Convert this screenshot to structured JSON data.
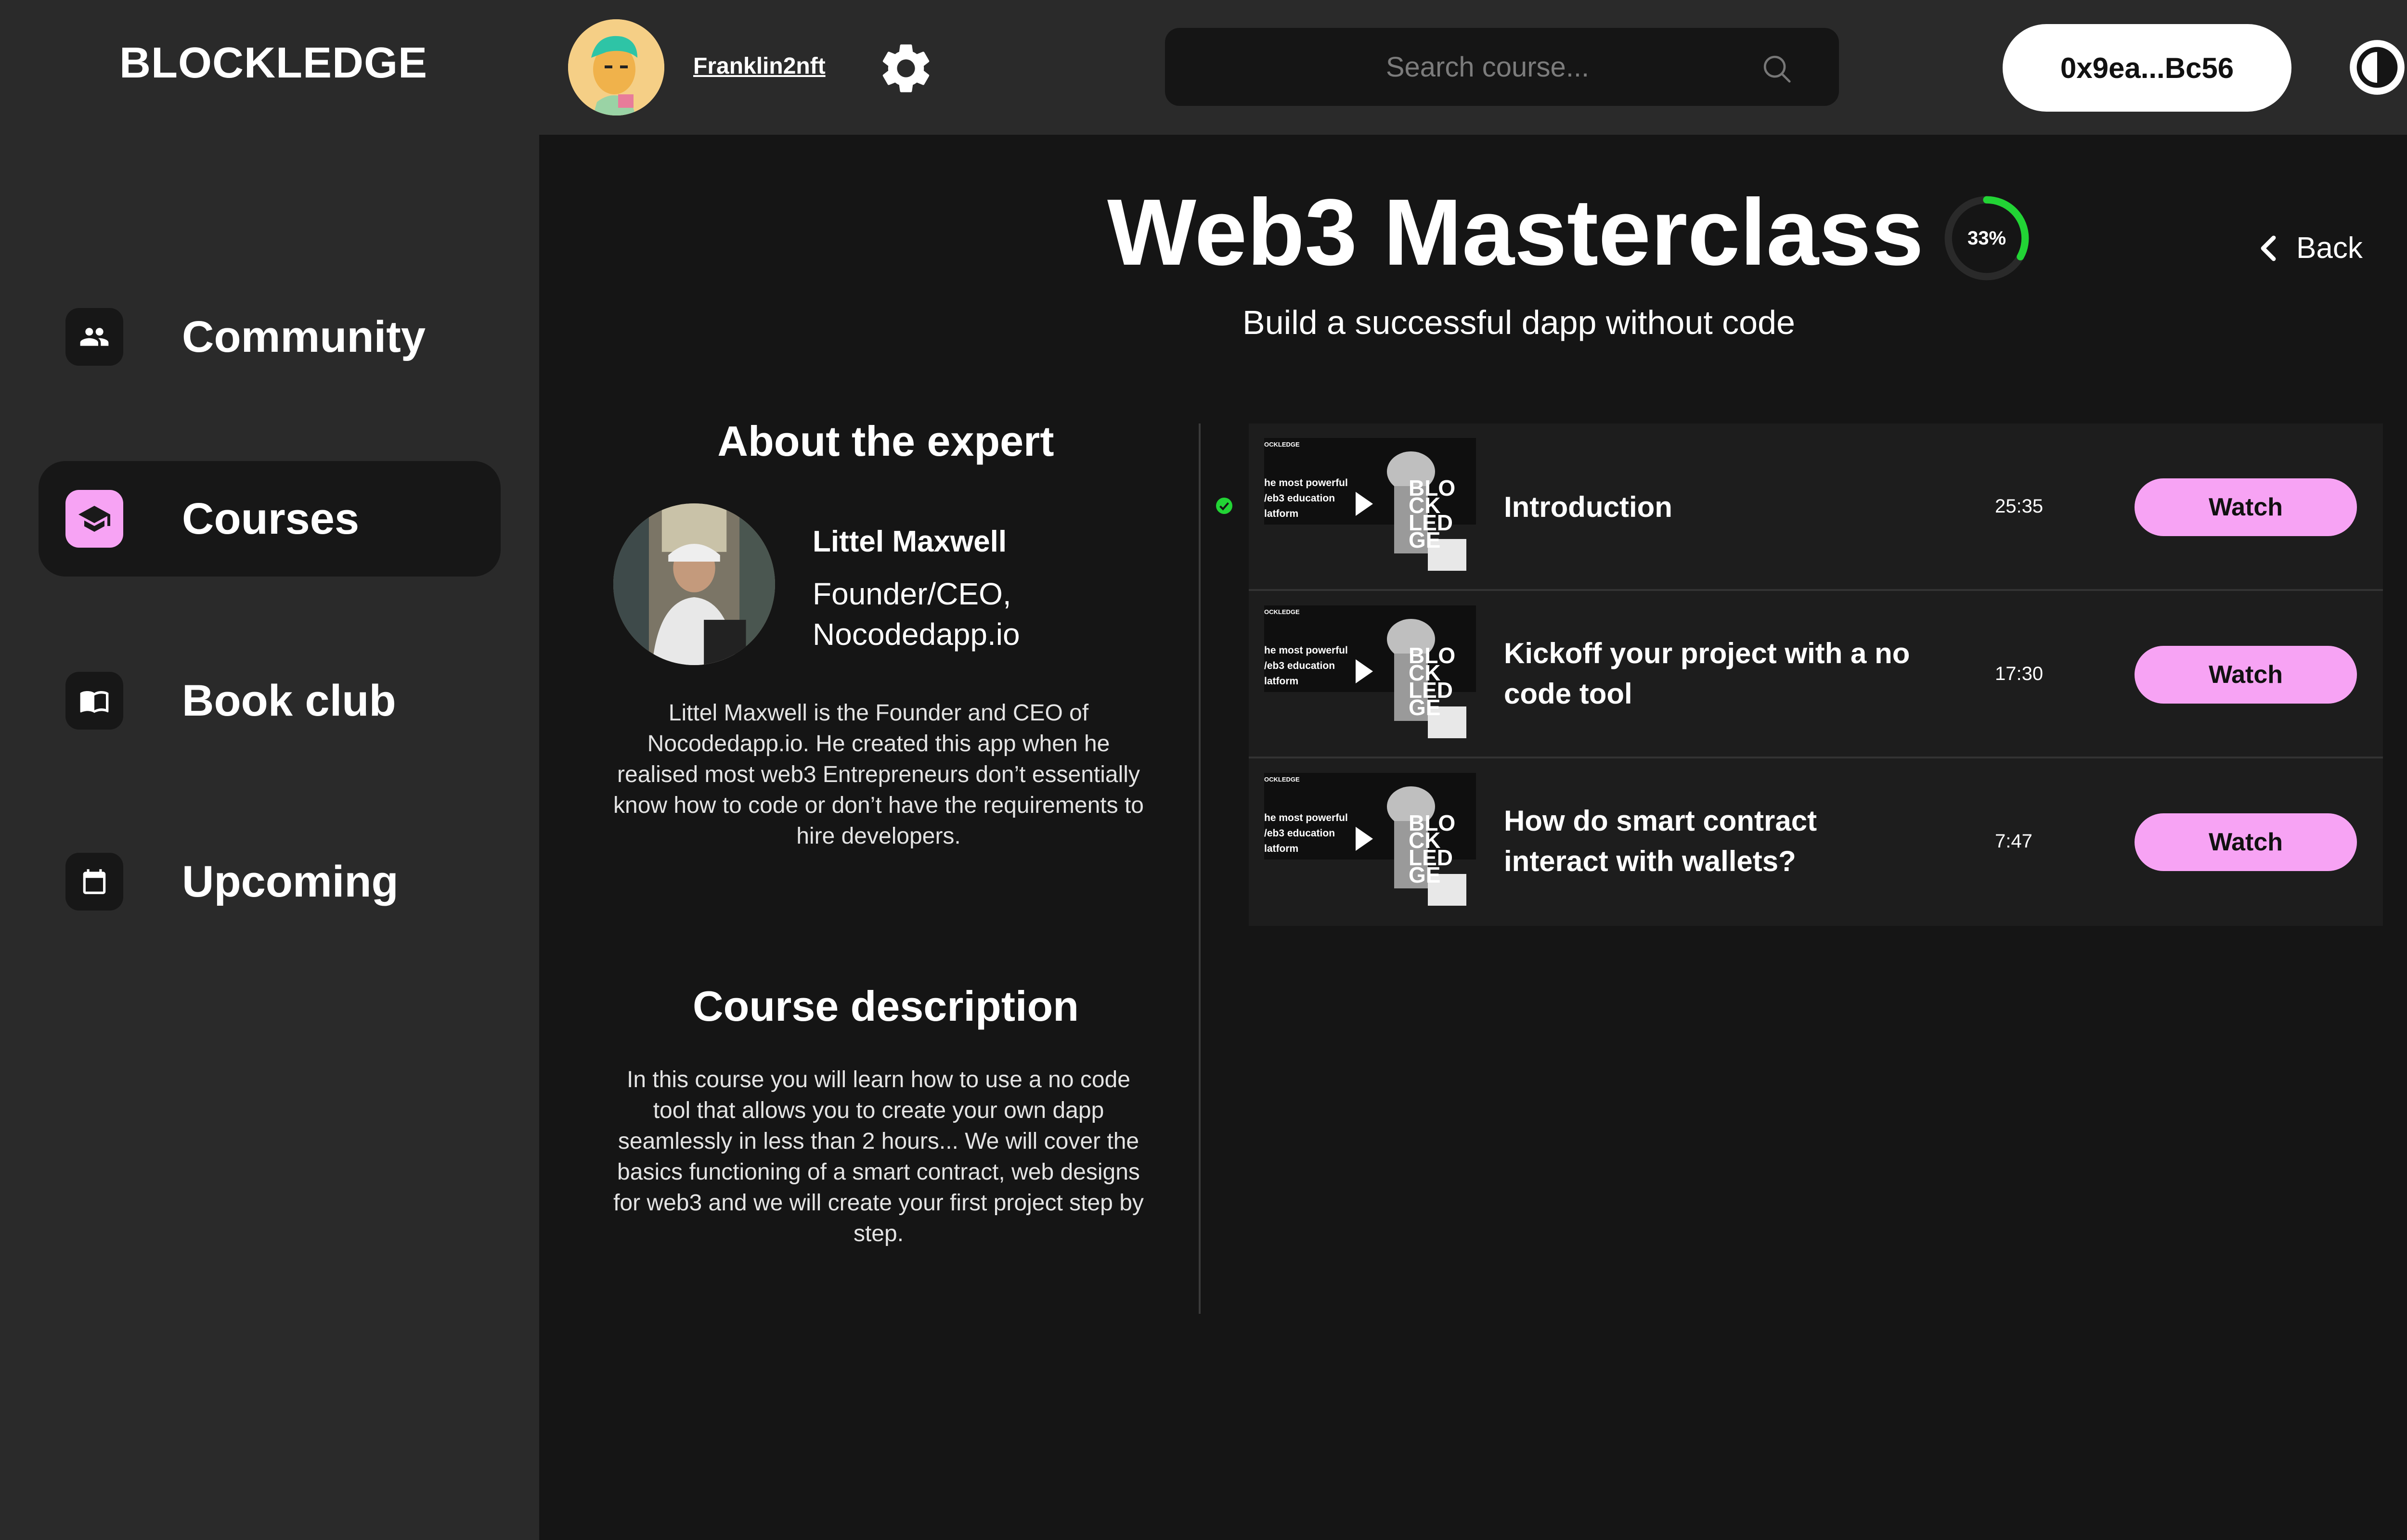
{
  "brand": {
    "logo": "BLOCKLEDGE"
  },
  "sidebar": {
    "items": [
      {
        "label": "Community",
        "icon": "people-icon",
        "active": false
      },
      {
        "label": "Courses",
        "icon": "graduation-cap-icon",
        "active": true
      },
      {
        "label": "Book club",
        "icon": "book-icon",
        "active": false
      },
      {
        "label": "Upcoming",
        "icon": "calendar-icon",
        "active": false
      }
    ]
  },
  "header": {
    "username": "Franklin2nft",
    "search_placeholder": "Search course...",
    "wallet": "0x9ea...Bc56"
  },
  "course": {
    "title": "Web3 Masterclass",
    "subtitle": "Build a successful dapp without code",
    "progress_label": "33%",
    "progress": 0.33,
    "back_label": "Back"
  },
  "expert": {
    "heading": "About the expert",
    "name": "Littel Maxwell",
    "role_line1": "Founder/CEO,",
    "role_line2": "Nocodedapp.io",
    "bio": "Littel Maxwell is the Founder and CEO of Nocodedapp.io. He created this app when he realised most web3 Entrepreneurs don’t essentially know how to code or don’t have the requirements to hire developers."
  },
  "description": {
    "heading": "Course description",
    "text": "In this course you will learn how to use a no code tool that allows you to create your own dapp seamlessly in less than 2 hours... We will cover the basics functioning of a smart contract,  web designs for web3 and we will create your first project step by step."
  },
  "thumbnail": {
    "brand": "OCKLEDGE",
    "tagline1": "he most powerful",
    "tagline2": "/eb3 education",
    "tagline3": "latform",
    "logo_line1": "BLO",
    "logo_line2": "CK",
    "logo_line3": "LED",
    "logo_line4": "GE"
  },
  "lessons": [
    {
      "title": "Introduction",
      "duration": "25:35",
      "button": "Watch",
      "completed": true
    },
    {
      "title": "Kickoff your project with a no code tool",
      "duration": "17:30",
      "button": "Watch",
      "completed": false
    },
    {
      "title": "How do smart contract interact with wallets?",
      "duration": "7:47",
      "button": "Watch",
      "completed": false
    }
  ],
  "colors": {
    "accent": "#f7a3f4",
    "progress": "#22d435",
    "sidebar_bg": "#2a2a2a",
    "main_bg": "#151515"
  }
}
